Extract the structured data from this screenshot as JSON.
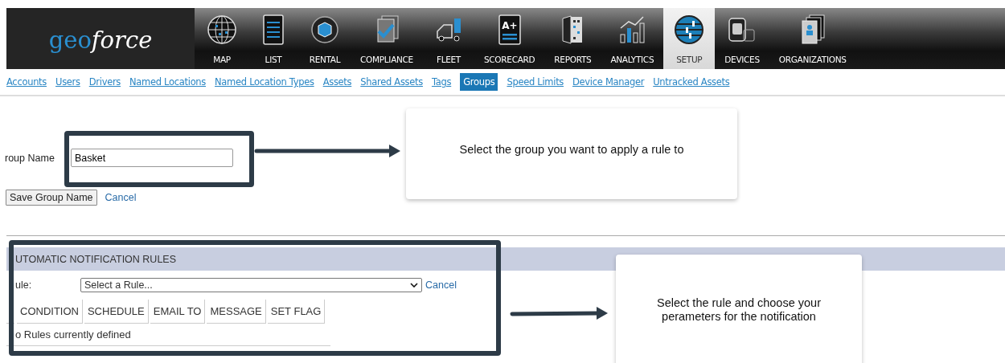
{
  "header": {
    "logo": [
      "geo",
      "force"
    ],
    "nav": [
      {
        "kind": "map",
        "label": "MAP",
        "selected": false
      },
      {
        "kind": "list",
        "label": "LIST",
        "selected": false
      },
      {
        "kind": "rental",
        "label": "RENTAL",
        "selected": false
      },
      {
        "kind": "compliance",
        "label": "COMPLIANCE",
        "selected": false
      },
      {
        "kind": "fleet",
        "label": "FLEET",
        "selected": false
      },
      {
        "kind": "scorecard",
        "label": "SCORECARD",
        "icon_text": "A+",
        "selected": false
      },
      {
        "kind": "reports",
        "label": "REPORTS",
        "selected": false
      },
      {
        "kind": "analytics",
        "label": "ANALYTICS",
        "selected": false
      },
      {
        "kind": "setup",
        "label": "SETUP",
        "selected": true
      },
      {
        "kind": "devices",
        "label": "DEVICES",
        "selected": false
      },
      {
        "kind": "organizations",
        "label": "ORGANIZATIONS",
        "selected": false
      }
    ]
  },
  "subnav": [
    {
      "label": "Accounts",
      "selected": false
    },
    {
      "label": "Users",
      "selected": false
    },
    {
      "label": "Drivers",
      "selected": false
    },
    {
      "label": "Named Locations",
      "selected": false
    },
    {
      "label": "Named Location Types",
      "selected": false
    },
    {
      "label": "Assets",
      "selected": false
    },
    {
      "label": "Shared Assets",
      "selected": false
    },
    {
      "label": "Tags",
      "selected": false
    },
    {
      "label": "Groups",
      "selected": true
    },
    {
      "label": "Speed Limits",
      "selected": false
    },
    {
      "label": "Device Manager",
      "selected": false
    },
    {
      "label": "Untracked Assets",
      "selected": false
    }
  ],
  "group_form": {
    "label": "roup Name",
    "value": "Basket",
    "save_button": "Save Group Name",
    "cancel": "Cancel"
  },
  "notification_rules": {
    "title": "UTOMATIC NOTIFICATION RULES",
    "rule_label": "ule:",
    "rule_select": "Select a Rule...",
    "cancel": "Cancel",
    "columns": [
      "CONDITION",
      "SCHEDULE",
      "EMAIL TO",
      "MESSAGE",
      "SET FLAG"
    ],
    "empty_message": "o Rules currently defined"
  },
  "callouts": [
    {
      "text": "Select the group you want to apply a rule to"
    },
    {
      "text": "Select the rule and choose your perameters for the notification"
    }
  ]
}
